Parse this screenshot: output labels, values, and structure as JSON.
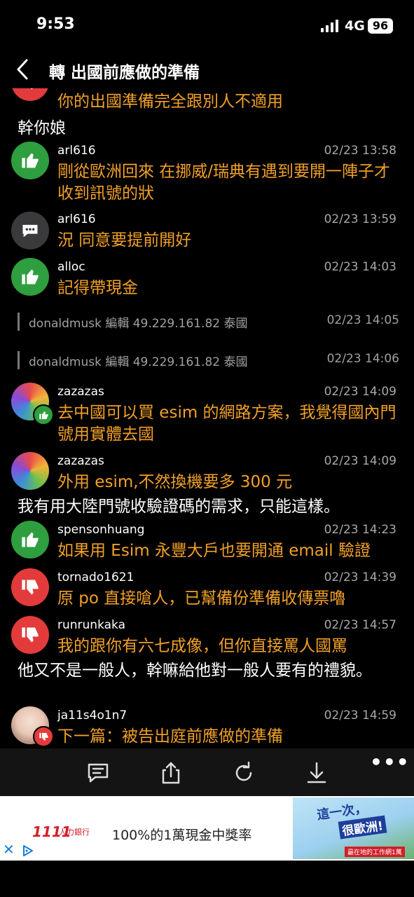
{
  "status_bar": {
    "time": "9:53",
    "network": "4G",
    "battery": "96"
  },
  "header": {
    "title": "轉 出國前應做的準備"
  },
  "feed": {
    "top_partial_message": "你的出國準備完全跟別人不適用",
    "items": [
      {
        "type": "plain",
        "text": "幹你娘"
      },
      {
        "type": "comment",
        "user": "arl616",
        "time": "02/23 13:58",
        "reaction": "up",
        "text": "剛從歐洲回來 在挪威/瑞典有遇到要開一陣子才收到訊號的狀"
      },
      {
        "type": "comment",
        "user": "arl616",
        "time": "02/23 13:59",
        "reaction": "chat",
        "text": "況 同意要提前開好"
      },
      {
        "type": "comment",
        "user": "alloc",
        "time": "02/23 14:03",
        "reaction": "up",
        "text": "記得帶現金"
      },
      {
        "type": "system",
        "text": "donaldmusk 編輯 49.229.161.82 泰國",
        "time": "02/23 14:05"
      },
      {
        "type": "system",
        "text": "donaldmusk 編輯 49.229.161.82 泰國",
        "time": "02/23 14:06"
      },
      {
        "type": "comment",
        "user": "zazazas",
        "time": "02/23 14:09",
        "reaction": "up",
        "text": "去中國可以買 esim 的網路方案，我覺得國內門號用實體去國"
      },
      {
        "type": "comment",
        "user": "zazazas",
        "time": "02/23 14:09",
        "reaction": "none",
        "text": "外用 esim,不然換機要多 300 元"
      },
      {
        "type": "plain",
        "text": "我有用大陸門號收驗證碼的需求，只能這樣。"
      },
      {
        "type": "comment",
        "user": "spensonhuang",
        "time": "02/23 14:23",
        "reaction": "up",
        "text": "如果用 Esim 永豐大戶也要開通 email 驗證"
      },
      {
        "type": "comment",
        "user": "tornado1621",
        "time": "02/23 14:39",
        "reaction": "down",
        "text": "原 po 直接嗆人，已幫備份準備收傳票嚕"
      },
      {
        "type": "comment",
        "user": "runrunkaka",
        "time": "02/23 14:57",
        "reaction": "down",
        "text": "我的跟你有六七成像，但你直接罵人國罵"
      },
      {
        "type": "plain",
        "text": "他又不是一般人，幹嘛給他對一般人要有的禮貌。"
      },
      {
        "type": "comment",
        "user": "ja11s4o1n7",
        "time": "02/23 14:59",
        "reaction": "down",
        "text": "下一篇：被告出庭前應做的準備"
      }
    ]
  },
  "toolbar": {
    "icons": [
      "comment-icon",
      "share-icon",
      "refresh-icon",
      "download-icon",
      "more-icon"
    ],
    "more_label": "•••"
  },
  "ad": {
    "logo_number": "1111",
    "logo_text": "人力銀行",
    "text": "100%的1萬現金中獎率",
    "banner_line1": "這一次，",
    "banner_line2": "很歐洲!",
    "banner_button": "最在地的工作網1萬",
    "close_label": "✕"
  },
  "colors": {
    "orange_text": "#f1a028",
    "upvote": "#2e9e3e",
    "downvote": "#e33b3b",
    "background": "#000000"
  }
}
